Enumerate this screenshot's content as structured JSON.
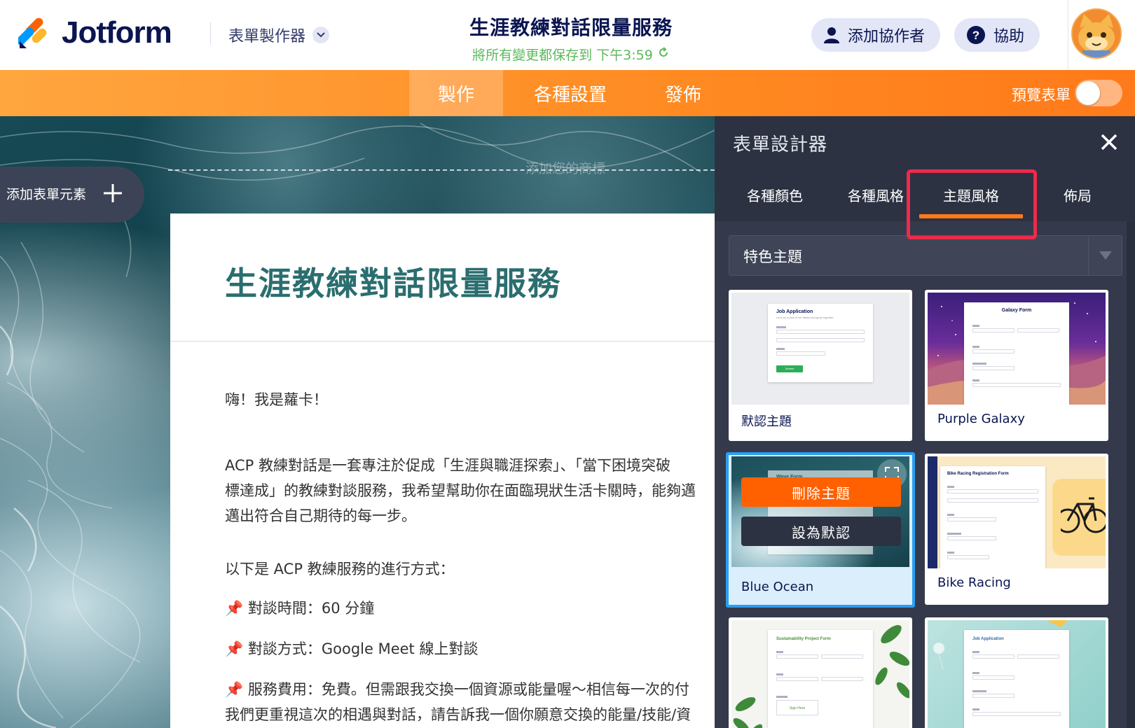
{
  "brand": {
    "name": "Jotform"
  },
  "header": {
    "builder_menu": "表單製作器",
    "form_title": "生涯教練對話限量服務",
    "save_status": "將所有變更都保存到 下午3:59",
    "add_collaborator": "添加協作者",
    "help": "協助"
  },
  "nav": {
    "tabs": [
      {
        "label": "製作",
        "active": true
      },
      {
        "label": "各種設置",
        "active": false
      },
      {
        "label": "發佈",
        "active": false
      }
    ],
    "preview_label": "預覽表單",
    "preview_enabled": false
  },
  "canvas": {
    "add_element_label": "添加表單元素",
    "logo_placeholder": "添加您的商標"
  },
  "form": {
    "title": "生涯教練對話限量服務",
    "greeting": "嗨！我是蘿卡！",
    "intro_line1": "ACP 教練對話是一套專注於促成「生涯與職涯探索」、「當下困境突破",
    "intro_line2": "標達成」的教練對談服務，我希望幫助你在面臨現狀生活卡關時，能夠邁",
    "intro_line3": "邁出符合自己期待的每一步。",
    "process_heading": "以下是 ACP 教練服務的進行方式：",
    "bullet1": "對談時間：60 分鐘",
    "bullet2": "對談方式：Google Meet 線上對談",
    "bullet3": "服務費用：免費。但需跟我交換一個資源或能量喔～相信每一次的付",
    "bullet3b": "我們更重視這次的相遇與對話，請告訴我一個你願意交換的能量/技能/資"
  },
  "designer": {
    "title": "表單設計器",
    "tabs": [
      {
        "label": "各種顏色",
        "active": false
      },
      {
        "label": "各種風格",
        "active": false
      },
      {
        "label": "主題風格",
        "active": true
      },
      {
        "label": "佈局",
        "active": false
      }
    ],
    "theme_select": "特色主題",
    "themes": [
      {
        "name": "默認主題",
        "preview_title": "Job Application",
        "preview_subtitle": "Let's be a part of our family and grow together.",
        "preview_button": "Submit",
        "selected": false
      },
      {
        "name": "Purple Galaxy",
        "preview_title": "Galaxy Form",
        "selected": false
      },
      {
        "name": "Blue Ocean",
        "preview_title": "Wave Form",
        "selected": true
      },
      {
        "name": "Bike Racing",
        "preview_title": "Bike Racing Registration Form",
        "selected": false
      },
      {
        "name": "",
        "preview_title": "Sustainability Project Form",
        "preview_note": "Sign Here",
        "selected": false
      },
      {
        "name": "",
        "preview_title": "Job Application",
        "selected": false
      }
    ],
    "delete_theme": "刪除主題",
    "set_default": "設為默認"
  },
  "colors": {
    "brand_navy": "#0a1551",
    "orange": "#ff7a1a",
    "accent_teal": "#2b6e6f",
    "highlight_red": "#ee2a4c",
    "selected_blue": "#2a9ff0"
  }
}
